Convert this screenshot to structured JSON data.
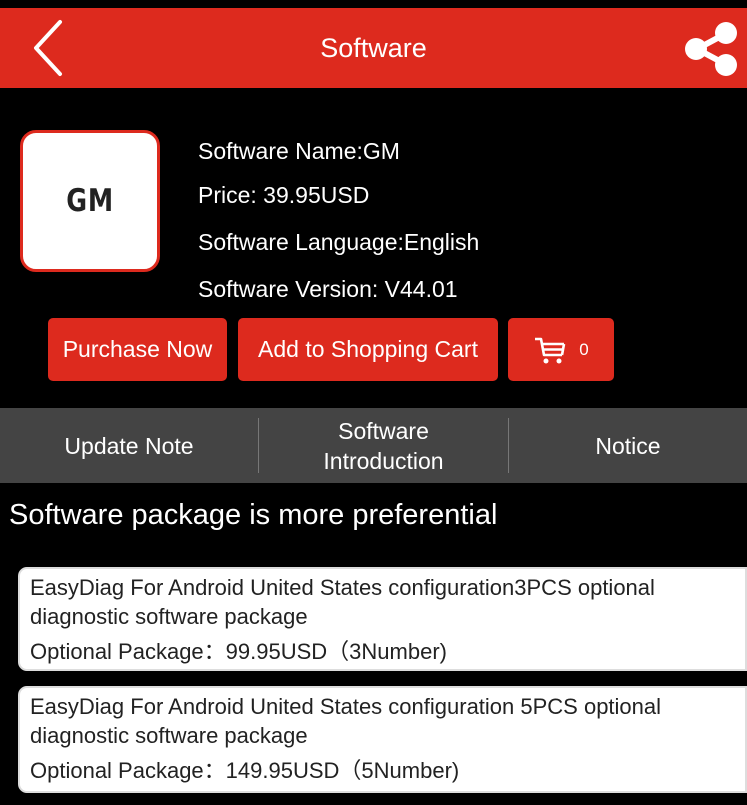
{
  "header": {
    "title": "Software",
    "back_icon": "chevron-left-icon",
    "share_icon": "share-icon",
    "bar_color": "#dd2a1e"
  },
  "software": {
    "logo_text": "GM",
    "name": "Software Name:GM",
    "price": "Price: 39.95USD",
    "language": "Software Language:English",
    "version": "Software Version: V44.01"
  },
  "actions": {
    "purchase_label": "Purchase Now",
    "add_cart_label": "Add to Shopping Cart",
    "cart_icon": "shopping-cart-icon",
    "cart_count": "0"
  },
  "tabs": [
    {
      "label": "Update Note"
    },
    {
      "label": "Software\nIntroduction"
    },
    {
      "label": "Notice"
    }
  ],
  "packages": {
    "section_title": "Software package is more preferential",
    "items": [
      {
        "name": "EasyDiag For Android United States configuration3PCS optional diagnostic software package",
        "price": "Optional Package：99.95USD（3Number)"
      },
      {
        "name": "EasyDiag For Android United States configuration 5PCS optional diagnostic software package",
        "price": "Optional Package：149.95USD（5Number)"
      }
    ]
  }
}
